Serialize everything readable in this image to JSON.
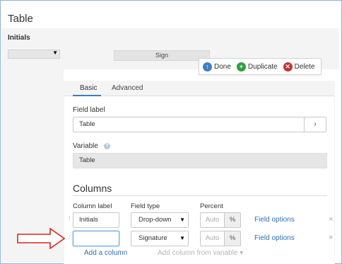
{
  "header": {
    "title": "Table"
  },
  "preview": {
    "initials_label": "Initials",
    "select_caret": "▼",
    "sign_button": "Sign"
  },
  "actions": {
    "done": {
      "label": "Done",
      "icon": "arrow-up-icon",
      "glyph": "↑",
      "color": "#3f7fc1"
    },
    "duplicate": {
      "label": "Duplicate",
      "icon": "plus-icon",
      "glyph": "+",
      "color": "#2e9e3e"
    },
    "delete": {
      "label": "Delete",
      "icon": "close-icon",
      "glyph": "✕",
      "color": "#c9302c"
    }
  },
  "tabs": [
    {
      "label": "Basic",
      "active": true
    },
    {
      "label": "Advanced",
      "active": false
    }
  ],
  "form": {
    "field_label": {
      "label": "Field label",
      "value": "Table",
      "button": "›"
    },
    "variable": {
      "label": "Variable",
      "help": "?",
      "value": "Table"
    }
  },
  "columns": {
    "title": "Columns",
    "headers": {
      "column_label": "Column label",
      "field_type": "Field type",
      "percent": "Percent"
    },
    "rows": [
      {
        "label": "Initials",
        "type": "Drop-down",
        "percent_placeholder": "Auto",
        "percent_suffix": "%",
        "options_link": "Field options",
        "remove": "×"
      },
      {
        "label": "",
        "type": "Signature",
        "percent_placeholder": "Auto",
        "percent_suffix": "%",
        "options_link": "Field options",
        "remove": "×"
      }
    ],
    "add_column": "Add a column",
    "add_from_variable": "Add column from variable ▾",
    "select_caret": "▼",
    "drag_glyph": "⋮"
  },
  "annotation": {
    "arrow_color": "#d9261c"
  }
}
